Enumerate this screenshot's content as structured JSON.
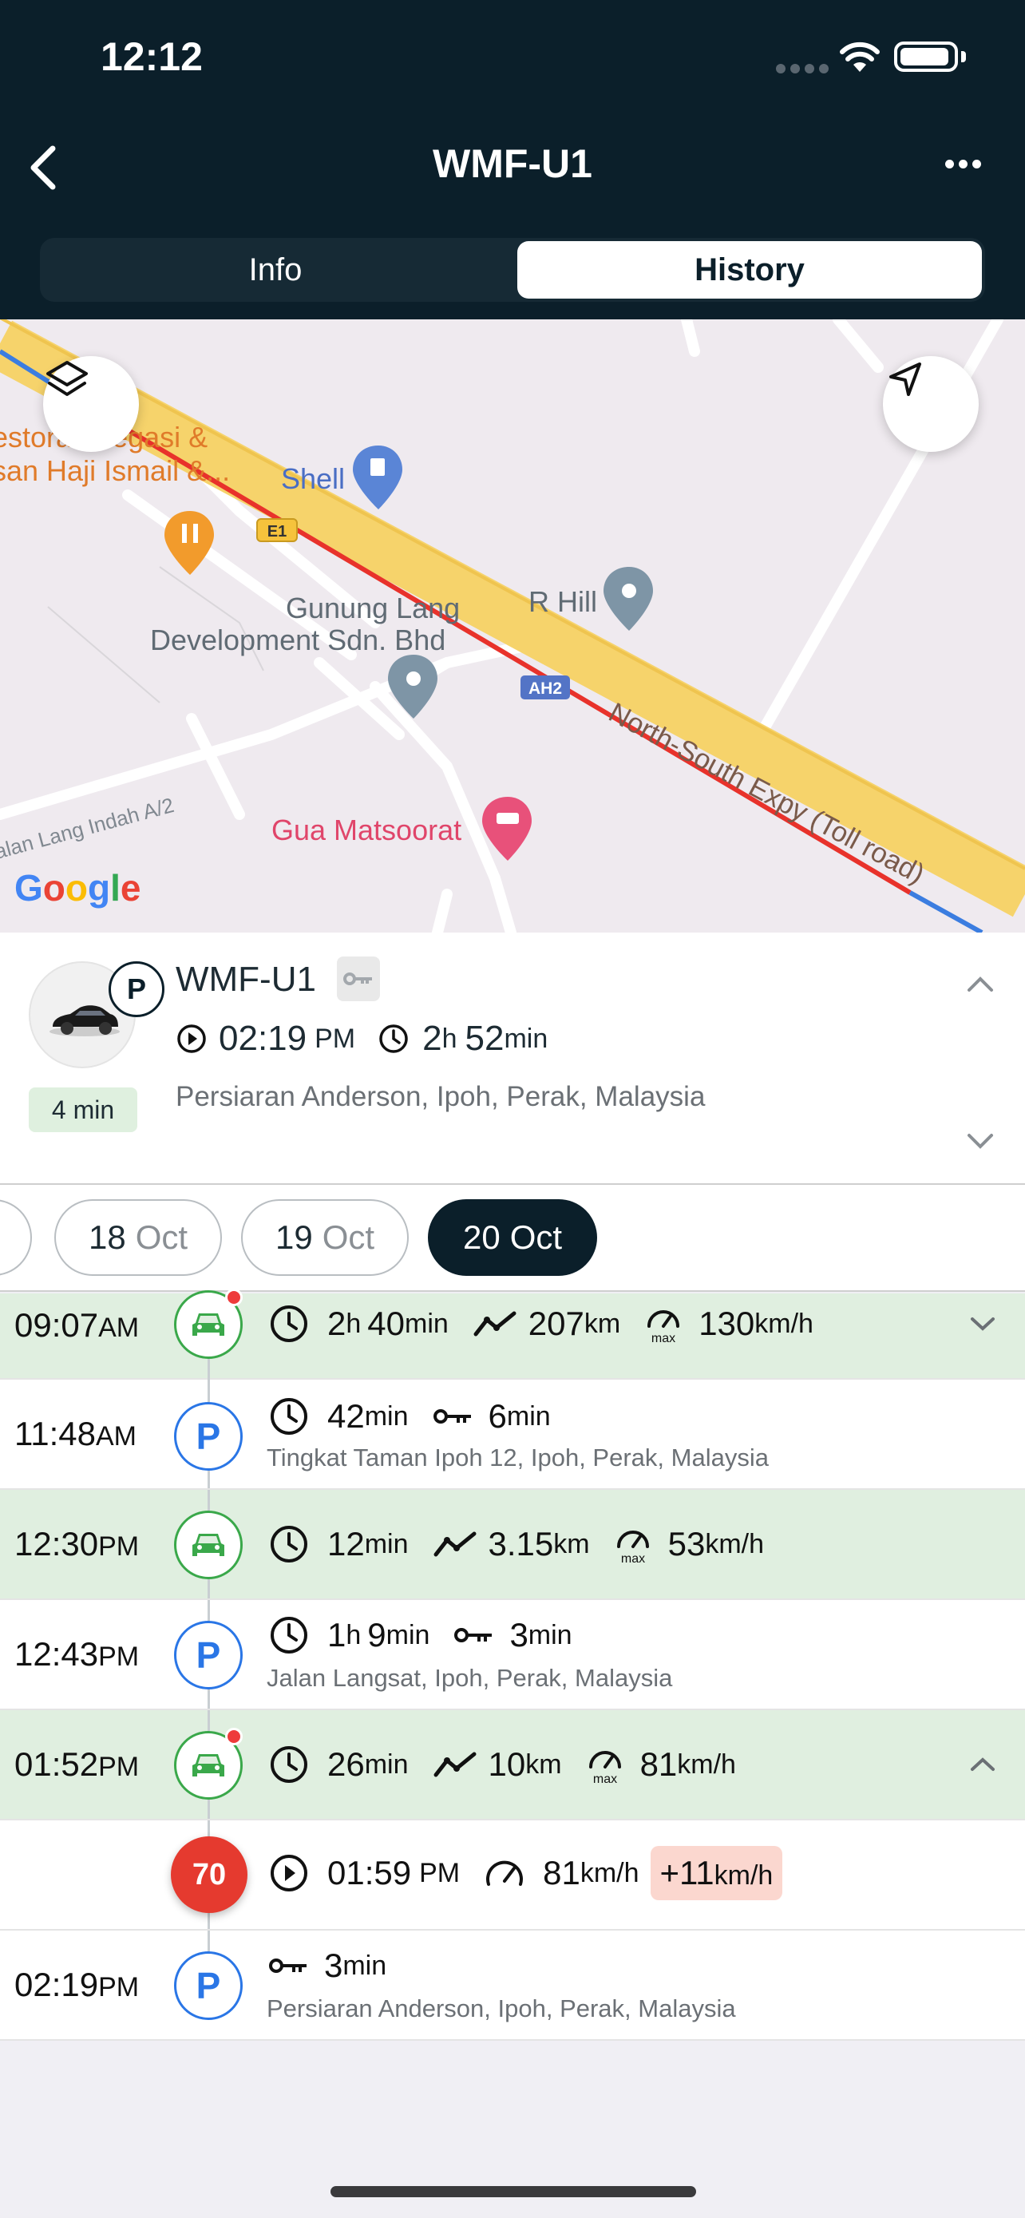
{
  "status_bar": {
    "time": "12:12"
  },
  "nav": {
    "title": "WMF-U1",
    "tabs": [
      "Info",
      "History"
    ],
    "active_tab": "History"
  },
  "map": {
    "labels": {
      "restaurant": "estoran Legasi &",
      "restaurant2": "san Haji Ismail &...",
      "shell": "Shell",
      "gunung1": "Gunung Lang",
      "gunung2": "Development Sdn. Bhd",
      "rhill": "R Hill",
      "e1": "E1",
      "ah2": "AH2",
      "expy": "North-South Expy (Toll road)",
      "jalan": "alan Lang Indah A/2",
      "gua": "Gua Matsoorat",
      "google": "Google"
    },
    "route_color": "#e8322b",
    "highway_color": "#f6d36b"
  },
  "vehicle_card": {
    "name": "WMF-U1",
    "status_letter": "P",
    "since_badge": "4 min",
    "start_time": "02:19",
    "start_ampm": "PM",
    "dur_h": "2",
    "dur_h_unit": "h",
    "dur_m": "52",
    "dur_m_unit": "min",
    "address": "Persiaran Anderson, Ipoh, Perak, Malaysia"
  },
  "dates": [
    {
      "day": "18",
      "month": "Oct",
      "active": false
    },
    {
      "day": "19",
      "month": "Oct",
      "active": false
    },
    {
      "day": "20",
      "month": "Oct",
      "active": true
    }
  ],
  "timeline": {
    "r1": {
      "time": "09:07",
      "ampm": "AM",
      "dur_h": "2",
      "dur_m": "40",
      "dist": "207",
      "dist_u": "km",
      "speed": "130",
      "speed_u": "km/h",
      "h": "h",
      "min": "min"
    },
    "r2": {
      "time": "11:48",
      "ampm": "AM",
      "dur": "42",
      "min": "min",
      "key": "6",
      "address": "Tingkat Taman Ipoh 12, Ipoh, Perak, Malaysia"
    },
    "r3": {
      "time": "12:30",
      "ampm": "PM",
      "dur": "12",
      "min": "min",
      "dist": "3.15",
      "dist_u": "km",
      "speed": "53",
      "speed_u": "km/h"
    },
    "r4": {
      "time": "12:43",
      "ampm": "PM",
      "dur_h": "1",
      "h": "h",
      "dur_m": "9",
      "min": "min",
      "key": "3",
      "address": "Jalan Langsat, Ipoh, Perak, Malaysia"
    },
    "r5": {
      "time": "01:52",
      "ampm": "PM",
      "dur": "26",
      "min": "min",
      "dist": "10",
      "dist_u": "km",
      "speed": "81",
      "speed_u": "km/h"
    },
    "r6": {
      "limit": "70",
      "time": "01:59",
      "ampm": "PM",
      "speed": "81",
      "speed_u": "km/h",
      "over": "+11",
      "over_u": "km/h"
    },
    "r7": {
      "time": "02:19",
      "ampm": "PM",
      "key": "3",
      "min": "min",
      "address": "Persiaran Anderson, Ipoh, Perak, Malaysia"
    }
  },
  "max_label": "max",
  "icons": [
    "back-chevron-icon",
    "more-icon",
    "layers-icon",
    "navigate-arrow-icon",
    "car-icon",
    "key-icon",
    "clock-icon",
    "play-icon",
    "route-icon",
    "speedometer-icon",
    "chevron-up-icon",
    "chevron-down-icon"
  ]
}
